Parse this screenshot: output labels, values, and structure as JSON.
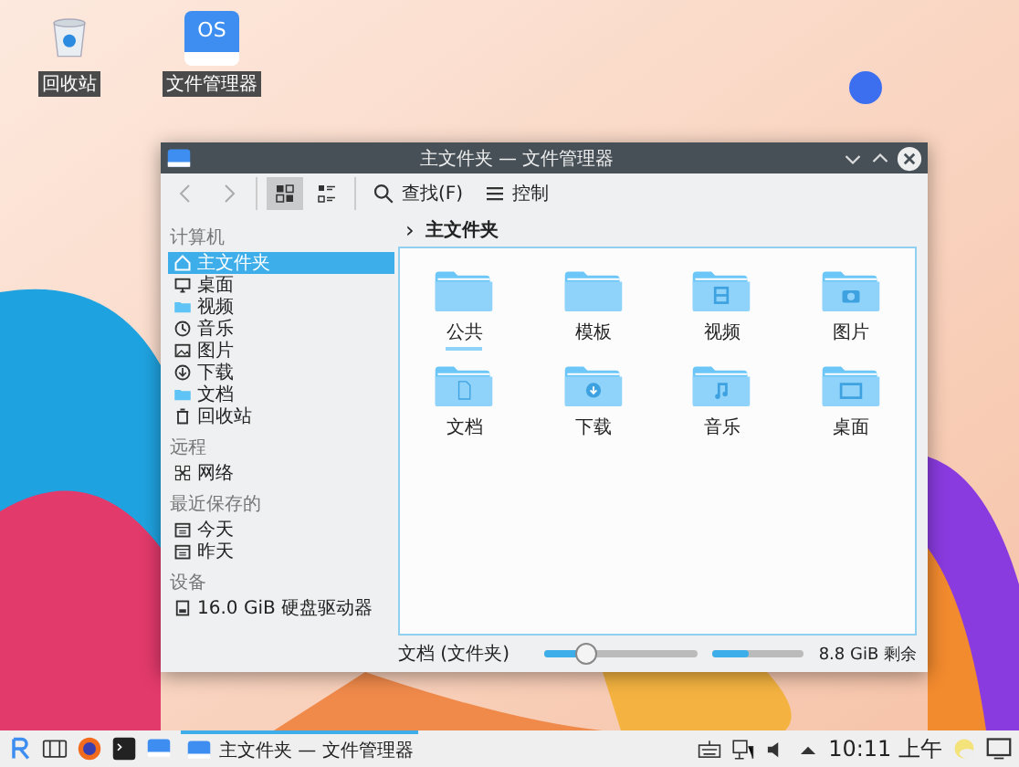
{
  "desktop_icons": [
    {
      "label": "回收站",
      "kind": "trash"
    },
    {
      "label": "文件管理器",
      "kind": "app",
      "icon_text": "OS"
    }
  ],
  "window": {
    "title": "主文件夹 — 文件管理器",
    "toolbar": {
      "back": {
        "disabled": true
      },
      "forward": {
        "disabled": true
      },
      "views": [
        {
          "kind": "icons",
          "selected": true
        },
        {
          "kind": "details",
          "selected": false
        }
      ],
      "buttons": [
        {
          "kind": "search",
          "label": "查找(F)"
        },
        {
          "kind": "menu",
          "label": "控制"
        }
      ]
    },
    "sidebar": [
      {
        "heading": "计算机",
        "items": [
          {
            "label": "主文件夹",
            "kind": "home",
            "selected": true
          },
          {
            "label": "桌面",
            "kind": "desktop",
            "selected": false
          },
          {
            "label": "视频",
            "kind": "folder",
            "selected": false
          },
          {
            "label": "音乐",
            "kind": "music",
            "selected": false
          },
          {
            "label": "图片",
            "kind": "image",
            "selected": false
          },
          {
            "label": "下载",
            "kind": "download",
            "selected": false
          },
          {
            "label": "文档",
            "kind": "folder",
            "selected": false
          },
          {
            "label": "回收站",
            "kind": "trash",
            "selected": false
          }
        ]
      },
      {
        "heading": "远程",
        "items": [
          {
            "label": "网络",
            "kind": "network",
            "selected": false
          }
        ]
      },
      {
        "heading": "最近保存的",
        "items": [
          {
            "label": "今天",
            "kind": "calendar",
            "selected": false
          },
          {
            "label": "昨天",
            "kind": "calendar",
            "selected": false
          }
        ]
      },
      {
        "heading": "设备",
        "items": [
          {
            "label": "16.0 GiB 硬盘驱动器",
            "kind": "drive",
            "selected": false
          }
        ]
      }
    ],
    "breadcrumb": {
      "separator": "›",
      "label": "主文件夹"
    },
    "files": [
      {
        "label": "公共",
        "kind": "plain",
        "focused": true
      },
      {
        "label": "模板",
        "kind": "plain",
        "focused": false
      },
      {
        "label": "视频",
        "kind": "video",
        "focused": false
      },
      {
        "label": "图片",
        "kind": "image",
        "focused": false
      },
      {
        "label": "文档",
        "kind": "document",
        "focused": false
      },
      {
        "label": "下载",
        "kind": "download",
        "focused": false
      },
      {
        "label": "音乐",
        "kind": "music",
        "focused": false
      },
      {
        "label": "桌面",
        "kind": "desktop",
        "focused": false
      }
    ],
    "status_bar": {
      "text": "文档 (文件夹)",
      "zoom": {
        "level": 0.27
      },
      "disk": {
        "level": 0.4
      },
      "free_space": "8.8 GiB 剩余"
    }
  },
  "taskbar": {
    "launchers": [
      {
        "kind": "logo"
      },
      {
        "kind": "desktops"
      },
      {
        "kind": "browser"
      },
      {
        "kind": "terminal"
      },
      {
        "kind": "app"
      }
    ],
    "tasks": [
      {
        "label": "主文件夹 — 文件管理器",
        "selected": true
      }
    ],
    "tray": [
      {
        "kind": "keyboard"
      },
      {
        "kind": "network"
      },
      {
        "kind": "volume"
      },
      {
        "kind": "expand"
      }
    ],
    "clock": "10:11 上午",
    "extra": [
      {
        "kind": "weather"
      },
      {
        "kind": "screen"
      }
    ]
  }
}
